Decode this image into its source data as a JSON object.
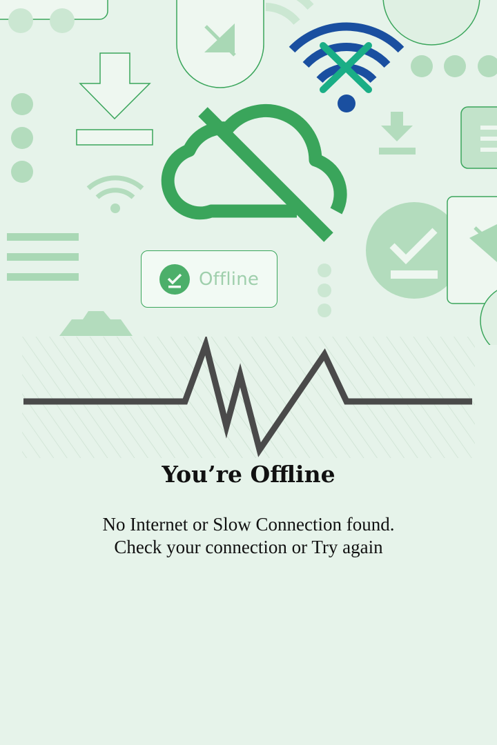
{
  "status_chip": {
    "label": "Offline",
    "icon": "check-download-icon"
  },
  "offline_message": {
    "title": "You’re Offline",
    "line1": "No Internet or Slow Connection found.",
    "line2": "Check your connection or Try again"
  },
  "icons": [
    "cloud-off-icon",
    "wifi-off-icon",
    "download-icon",
    "wifi-icon",
    "menu-lines-icon",
    "signal-off-icon",
    "check-circle-icon",
    "pulse-line-icon"
  ],
  "colors": {
    "background": "#e6f3ea",
    "brand_green": "#3aa55b",
    "light_green": "#b3dcbd",
    "wifi_blue": "#1a4fa0",
    "cross_teal": "#1aae86",
    "pulse_gray": "#4a4a4a",
    "text": "#111111"
  }
}
